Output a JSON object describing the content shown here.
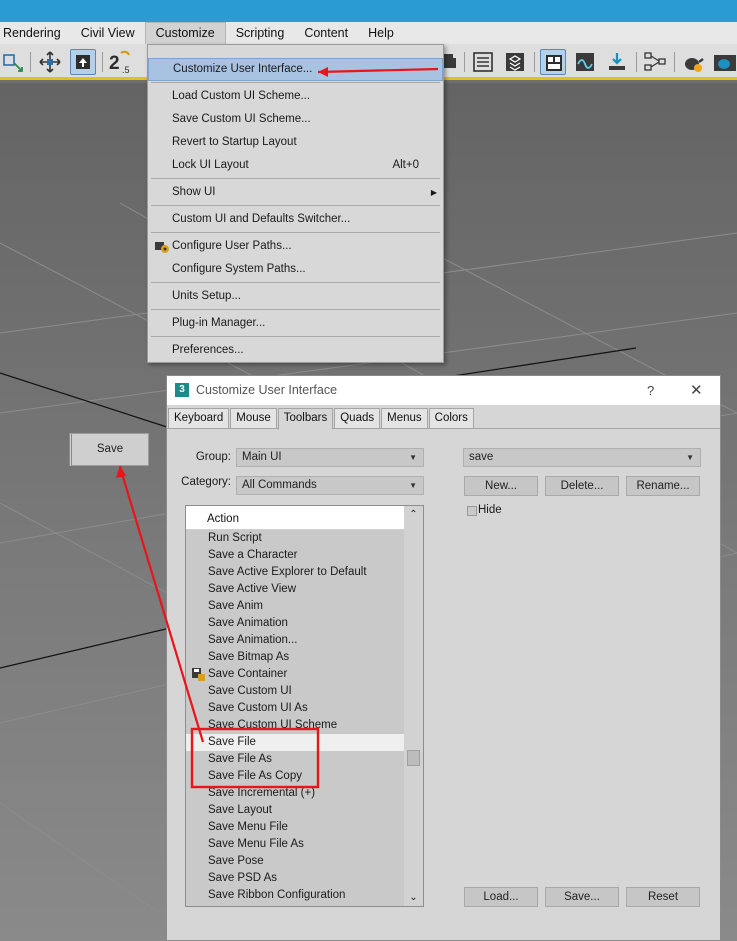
{
  "menubar": {
    "items": [
      "Rendering",
      "Civil View",
      "Customize",
      "Scripting",
      "Content",
      "Help"
    ]
  },
  "toolbar": {
    "icons": [
      "select-move-icon",
      "move-icon",
      "select-object-icon",
      "snap-2-5d-icon",
      "toolbar-icon",
      "layer-list-icon",
      "layers-icon",
      "toggle-ribbon-icon",
      "curve-editor-icon",
      "render-setup-icon",
      "schematic-view-icon",
      "render-teapot-icon",
      "render-frame-icon"
    ]
  },
  "customize_menu": {
    "items": [
      {
        "label": "Customize User Interface...",
        "highlighted": true
      },
      {
        "label": "Load Custom UI Scheme..."
      },
      {
        "label": "Save Custom UI Scheme..."
      },
      {
        "label": "Revert to Startup Layout"
      },
      {
        "label": "Lock UI Layout",
        "shortcut": "Alt+0"
      },
      {
        "label": "Show UI",
        "submenu": true
      },
      {
        "label": "Custom UI and Defaults Switcher..."
      },
      {
        "label": "Configure User Paths...",
        "icon": "gear-folder-icon"
      },
      {
        "label": "Configure System Paths..."
      },
      {
        "label": "Units Setup..."
      },
      {
        "label": "Plug-in Manager..."
      },
      {
        "label": "Preferences..."
      }
    ]
  },
  "floating_button": {
    "label": "Save"
  },
  "dialog": {
    "title": "Customize User Interface",
    "help": "?",
    "close": "✕",
    "tabs": [
      "Keyboard",
      "Mouse",
      "Toolbars",
      "Quads",
      "Menus",
      "Colors"
    ],
    "active_tab": "Toolbars",
    "group_label": "Group:",
    "group_value": "Main UI",
    "category_label": "Category:",
    "category_value": "All Commands",
    "toolbar_value": "save",
    "new_button": "New...",
    "delete_button": "Delete...",
    "rename_button": "Rename...",
    "hide_label": "Hide",
    "list_header": "Action",
    "actions": [
      {
        "label": "Run Script"
      },
      {
        "label": "Save a Character"
      },
      {
        "label": "Save Active Explorer to Default"
      },
      {
        "label": "Save Active View"
      },
      {
        "label": "Save Anim"
      },
      {
        "label": "Save Animation"
      },
      {
        "label": "Save Animation..."
      },
      {
        "label": "Save Bitmap As"
      },
      {
        "label": "Save Container",
        "icon": "container-save-icon"
      },
      {
        "label": "Save Custom UI"
      },
      {
        "label": "Save Custom UI As"
      },
      {
        "label": "Save Custom UI Scheme"
      },
      {
        "label": "Save File",
        "selected": true
      },
      {
        "label": "Save File As"
      },
      {
        "label": "Save File As Copy"
      },
      {
        "label": "Save Incremental (+)"
      },
      {
        "label": "Save Layout"
      },
      {
        "label": "Save Menu File"
      },
      {
        "label": "Save Menu File As"
      },
      {
        "label": "Save Pose"
      },
      {
        "label": "Save PSD As"
      },
      {
        "label": "Save Ribbon Configuration"
      }
    ],
    "load_button": "Load...",
    "save_button": "Save...",
    "reset_button": "Reset"
  },
  "colors": {
    "title_bar": "#2b9bd3",
    "menu_highlight": "#a8c3e1",
    "annotation": "#e8151b",
    "toolbar_accent": "#e1c318"
  }
}
